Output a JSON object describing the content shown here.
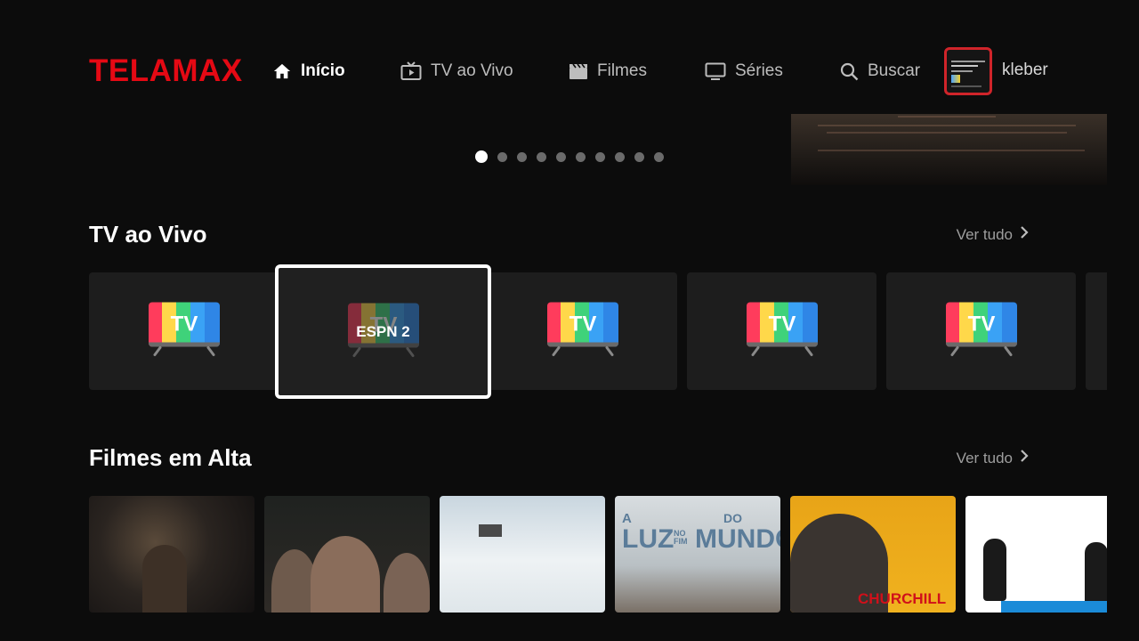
{
  "brand": {
    "logo": "TELAMAX",
    "color": "#e50914"
  },
  "nav": {
    "items": [
      {
        "label": "Início",
        "icon": "home-icon",
        "active": true
      },
      {
        "label": "TV ao Vivo",
        "icon": "live-tv-icon",
        "active": false
      },
      {
        "label": "Filmes",
        "icon": "movie-clapper-icon",
        "active": false
      },
      {
        "label": "Séries",
        "icon": "monitor-icon",
        "active": false
      },
      {
        "label": "Buscar",
        "icon": "search-icon",
        "active": false
      }
    ],
    "user": {
      "name": "kleber",
      "avatar_border": "#d0242a"
    }
  },
  "carousel": {
    "count": 10,
    "active_index": 0
  },
  "live_tv": {
    "title": "TV ao Vivo",
    "see_all": "Ver tudo",
    "focused_channel": "ESPN 2"
  },
  "trending_movies": {
    "title": "Filmes em Alta",
    "see_all": "Ver tudo",
    "posters": [
      {
        "title_text": ""
      },
      {
        "title_text": ""
      },
      {
        "title_text": ""
      },
      {
        "title_text_parts": [
          "A",
          "LUZ",
          "NO FIM",
          "DO",
          "MUNDO"
        ]
      },
      {
        "title_text": "CHURCHILL"
      },
      {
        "title_text": ""
      }
    ]
  }
}
